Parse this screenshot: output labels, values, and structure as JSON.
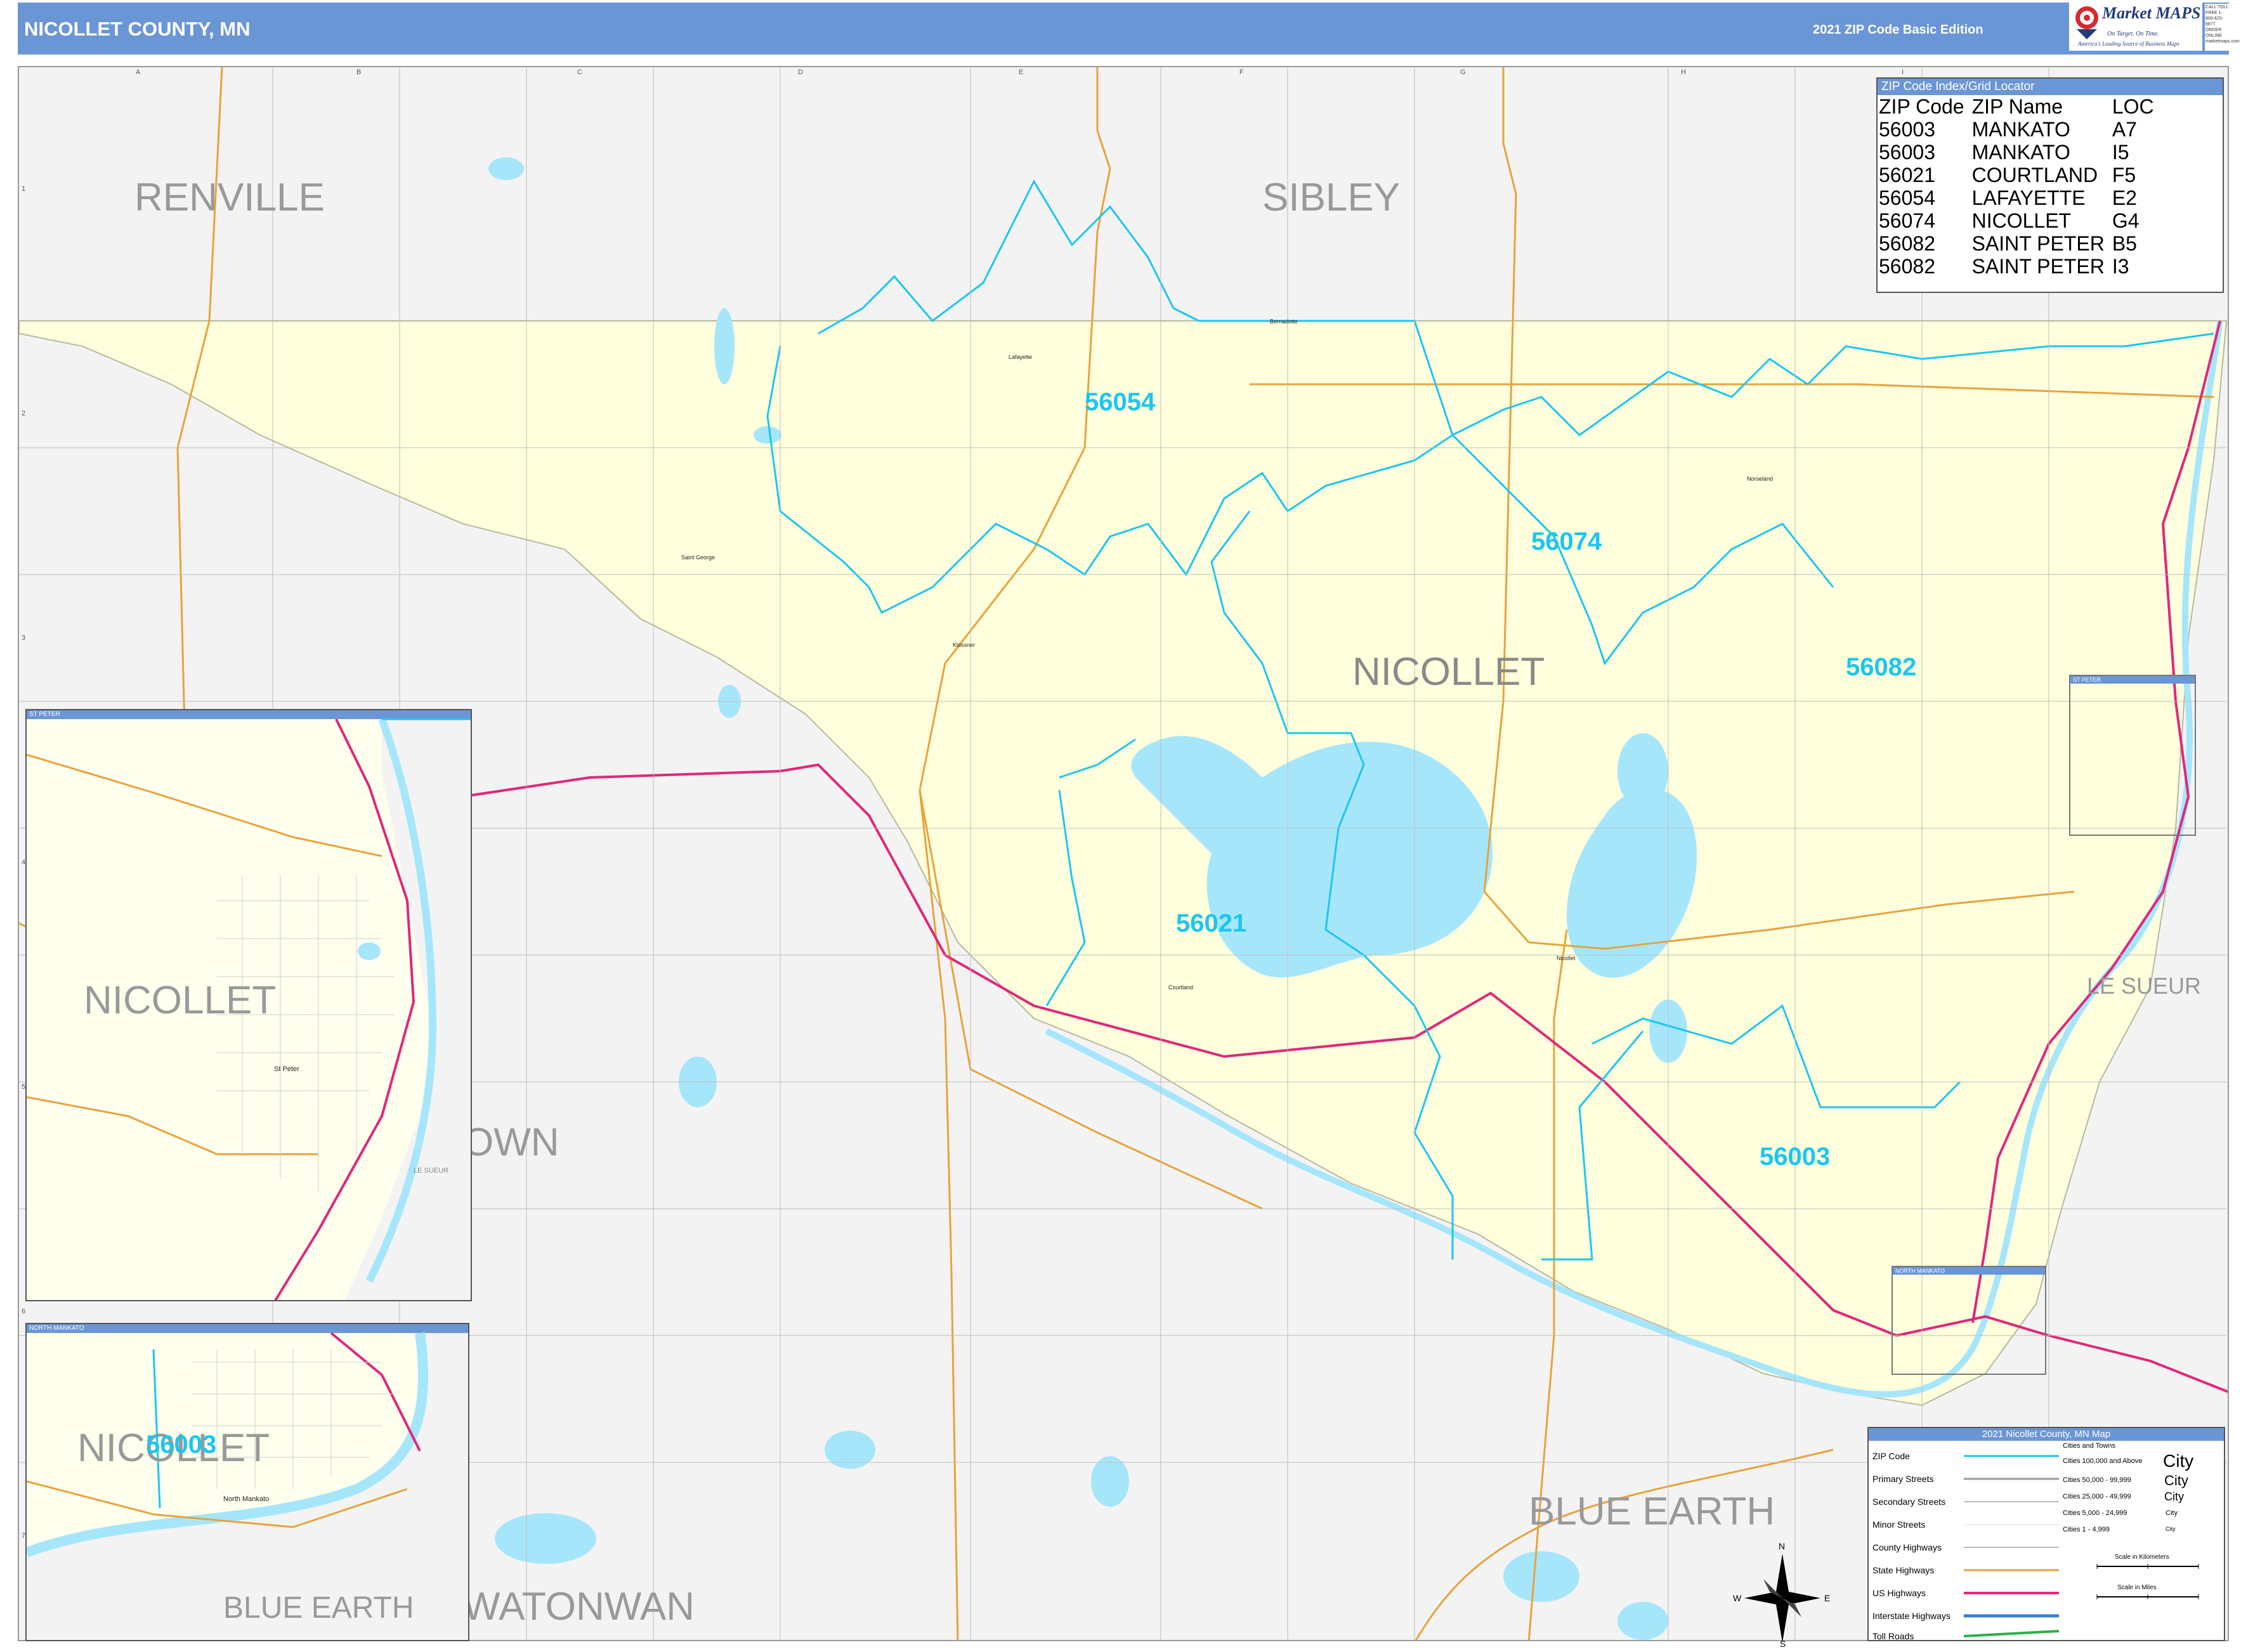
{
  "header": {
    "title": "NICOLLET COUNTY, MN",
    "edition": "2021 ZIP Code Basic Edition",
    "brand": "Market MAPS",
    "tagline": "On Target. On Time.",
    "tagline2": "America's Leading Source of Business Maps",
    "contact": "CALL TOLL FREE 1-800-425-6877 ORDER ONLINE marketmaps.com"
  },
  "grid": {
    "columns": [
      "A",
      "B",
      "C",
      "D",
      "E",
      "F",
      "G",
      "H",
      "I"
    ],
    "rows": [
      "1",
      "2",
      "3",
      "4",
      "5",
      "6",
      "7"
    ]
  },
  "counties": {
    "renville": "RENVILLE",
    "sibley": "SIBLEY",
    "nicollet": "NICOLLET",
    "le_sueur": "LE SUEUR",
    "brown": "OWN",
    "blue_earth": "BLUE EARTH",
    "watonwan": "WATONWAN"
  },
  "zips": {
    "z56054": "56054",
    "z56074": "56074",
    "z56082": "56082",
    "z56021": "56021",
    "z56003": "56003"
  },
  "towns": {
    "bernadotte": "Bernadotte",
    "lafayette": "Lafayette",
    "saint_george": "Saint George",
    "klossner": "Klossner",
    "courtland": "Courtland",
    "nicollet": "Nicollet",
    "norseland": "Norseland"
  },
  "insets": {
    "st_peter": {
      "title": "ST PETER",
      "county": "NICOLLET",
      "town": "St Peter",
      "le_sueur": "LE SUEUR"
    },
    "north_mankato": {
      "title": "NORTH MANKATO",
      "county": "NICOLLET",
      "zip": "56003",
      "town": "North Mankato",
      "blue_earth": "BLUE EARTH"
    },
    "st_peter_small": "ST PETER",
    "north_mankato_small": "NORTH MANKATO"
  },
  "zip_index": {
    "title": "ZIP Code Index/Grid Locator",
    "headers": [
      "ZIP Code",
      "ZIP Name",
      "LOC"
    ],
    "rows": [
      [
        "56003",
        "MANKATO",
        "A7"
      ],
      [
        "56003",
        "MANKATO",
        "I5"
      ],
      [
        "56021",
        "COURTLAND",
        "F5"
      ],
      [
        "56054",
        "LAFAYETTE",
        "E2"
      ],
      [
        "56074",
        "NICOLLET",
        "G4"
      ],
      [
        "56082",
        "SAINT PETER",
        "B5"
      ],
      [
        "56082",
        "SAINT PETER",
        "I3"
      ]
    ]
  },
  "legend": {
    "title": "2021 Nicollet County, MN Map",
    "items": [
      "ZIP Code",
      "Primary Streets",
      "Secondary Streets",
      "Minor Streets",
      "County Highways",
      "State Highways",
      "US Highways",
      "Interstate Highways",
      "Toll Roads"
    ],
    "cities_title": "Cities and Towns",
    "cities": [
      "Cities 100,000 and Above",
      "Cities 50,000 - 99,999",
      "Cities 25,000 - 49,999",
      "Cities 5,000 - 24,999",
      "Cities 1 - 4,999"
    ],
    "city_samples": [
      "City",
      "City",
      "City",
      "City",
      "City"
    ],
    "scale_km": "Scale in Kilometers",
    "scale_mi": "Scale in Miles",
    "compass": {
      "n": "N",
      "s": "S",
      "e": "E",
      "w": "W"
    }
  },
  "colors": {
    "header": "#6b96d6",
    "county_fill": "#ffffdd",
    "outside_fill": "#f3f3f3",
    "water": "#a6e6fb",
    "zip_line": "#1cc6f0",
    "us_highway": "#e0287a",
    "state_highway": "#e8a33c"
  }
}
